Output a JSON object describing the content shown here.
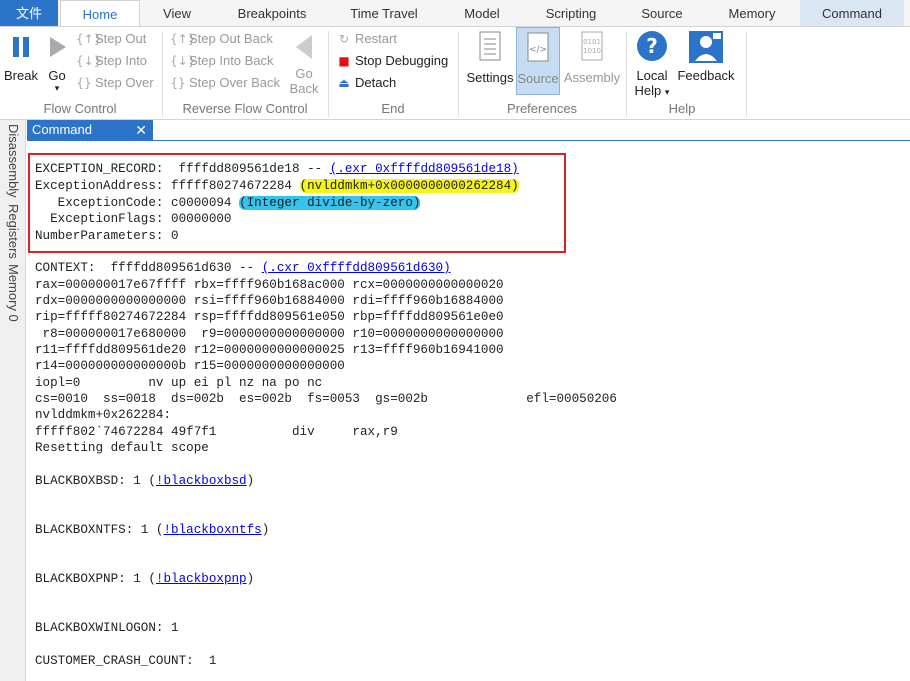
{
  "menu": {
    "file": "文件",
    "tabs": [
      "Home",
      "View",
      "Breakpoints",
      "Time Travel",
      "Model",
      "Scripting",
      "Source",
      "Memory",
      "Command"
    ]
  },
  "ribbon": {
    "flow": {
      "break": "Break",
      "go": "Go",
      "step_out": "Step Out",
      "step_into": "Step Into",
      "step_over": "Step Over",
      "label": "Flow Control"
    },
    "reverse": {
      "step_out_back": "Step Out Back",
      "step_into_back": "Step Into Back",
      "step_over_back": "Step Over Back",
      "go_back_1": "Go",
      "go_back_2": "Back",
      "label": "Reverse Flow Control"
    },
    "end": {
      "restart": "Restart",
      "stop": "Stop Debugging",
      "detach": "Detach",
      "label": "End"
    },
    "prefs": {
      "settings": "Settings",
      "source": "Source",
      "assembly": "Assembly",
      "label": "Preferences"
    },
    "help": {
      "local_1": "Local",
      "local_2": "Help",
      "feedback": "Feedback",
      "label": "Help"
    }
  },
  "side_tabs": [
    "Disassembly",
    "Registers",
    "Memory 0"
  ],
  "panel": {
    "title": "Command",
    "close": "✕"
  },
  "console": {
    "exc_record_pre": "EXCEPTION_RECORD:  ffffdd809561de18 -- ",
    "exc_record_link": "(.exr 0xffffdd809561de18)",
    "exc_addr_pre": "ExceptionAddress: fffff80274672284 ",
    "exc_addr_hl": "(nvlddmkm+0x0000000000262284)",
    "exc_code_pre": "   ExceptionCode: c0000094 ",
    "exc_code_hl": "(Integer divide-by-zero)",
    "exc_flags": "  ExceptionFlags: 00000000",
    "num_params": "NumberParameters: 0",
    "context_pre": "CONTEXT:  ffffdd809561d630 -- ",
    "context_link": "(.cxr 0xffffdd809561d630)",
    "regs": [
      "rax=000000017e67ffff rbx=ffff960b168ac000 rcx=0000000000000020",
      "rdx=0000000000000000 rsi=ffff960b16884000 rdi=ffff960b16884000",
      "rip=fffff80274672284 rsp=ffffdd809561e050 rbp=ffffdd809561e0e0",
      " r8=000000017e680000  r9=0000000000000000 r10=0000000000000000",
      "r11=ffffdd809561de20 r12=0000000000000025 r13=ffff960b16941000",
      "r14=000000000000000b r15=0000000000000000",
      "iopl=0         nv up ei pl nz na po nc",
      "cs=0010  ss=0018  ds=002b  es=002b  fs=0053  gs=002b             efl=00050206",
      "nvlddmkm+0x262284:",
      "fffff802`74672284 49f7f1          div     rax,r9",
      "Resetting default scope"
    ],
    "bb_bsd_pre": "BLACKBOXBSD: 1 (",
    "bb_bsd_link": "!blackboxbsd",
    "bb_ntfs_pre": "BLACKBOXNTFS: 1 (",
    "bb_ntfs_link": "!blackboxntfs",
    "bb_pnp_pre": "BLACKBOXPNP: 1 (",
    "bb_pnp_link": "!blackboxpnp",
    "close_paren": ")",
    "bb_winlogon": "BLACKBOXWINLOGON: 1",
    "crash_count": "CUSTOMER_CRASH_COUNT:  1"
  }
}
